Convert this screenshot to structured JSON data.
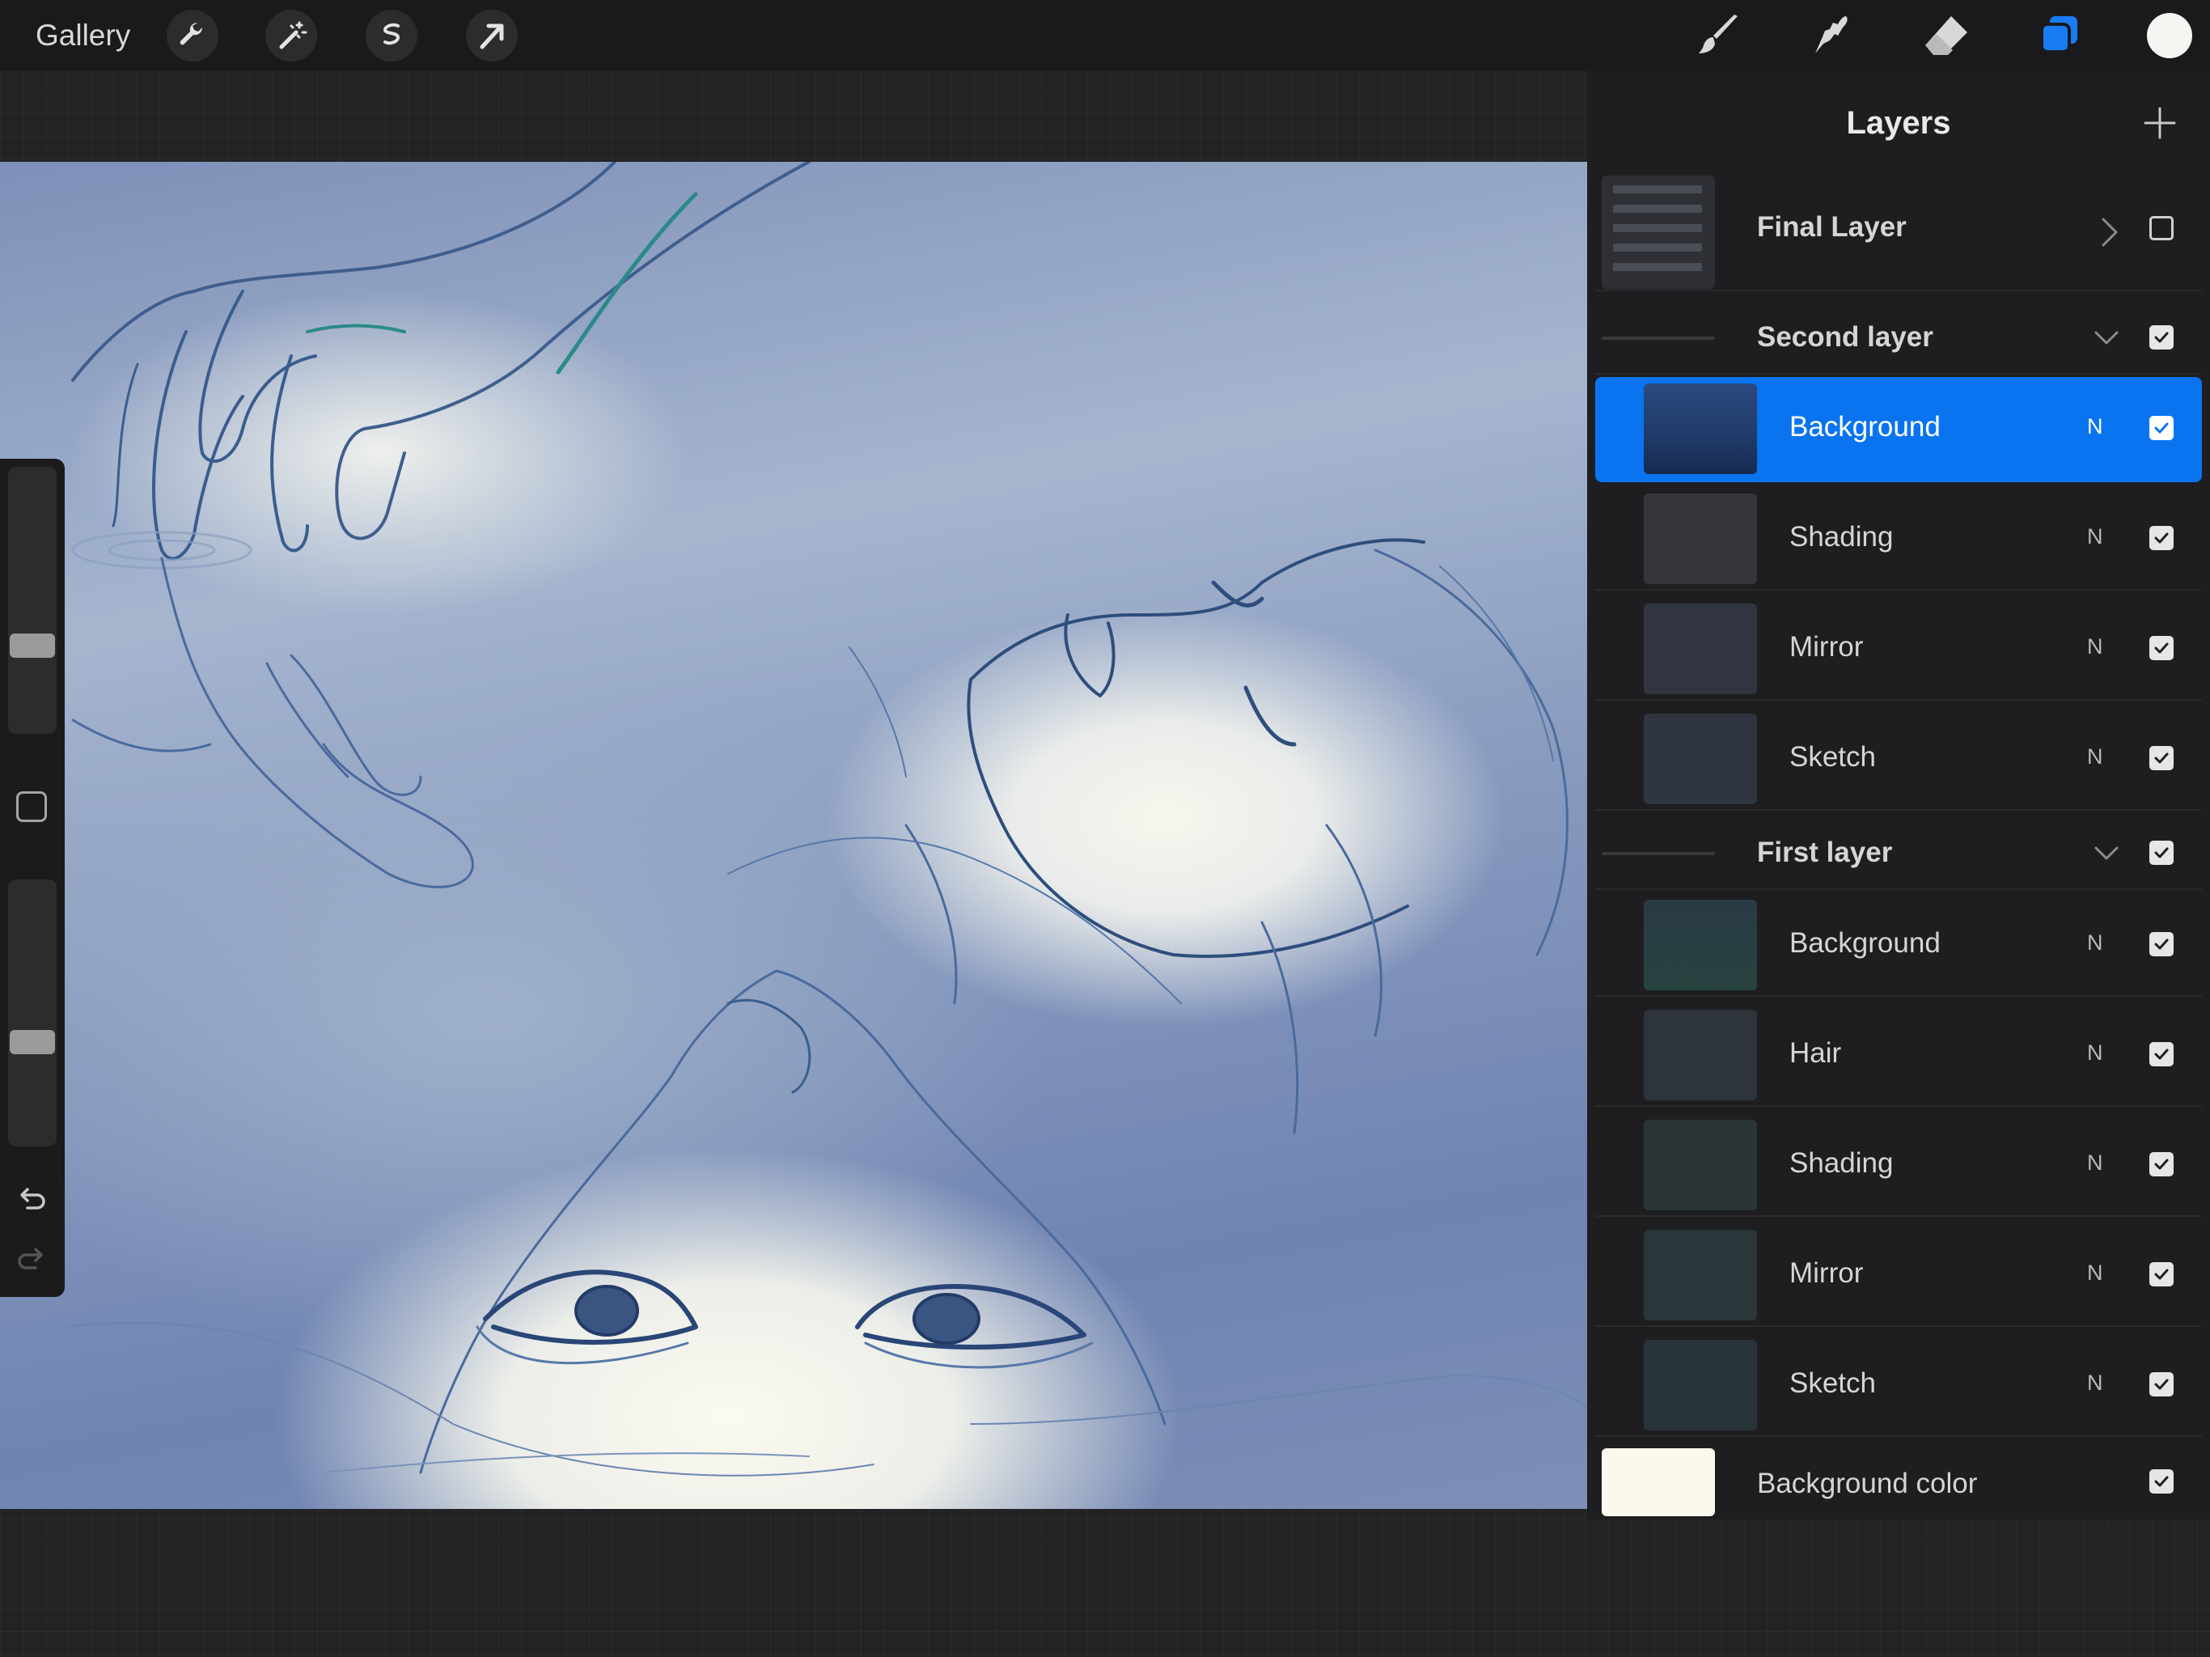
{
  "topbar": {
    "gallery_label": "Gallery",
    "left_tools": [
      "wrench-icon",
      "magic-wand-icon",
      "selection-icon",
      "transform-arrow-icon"
    ],
    "right_tools": [
      "brush-icon",
      "smudge-icon",
      "eraser-icon",
      "layers-icon"
    ],
    "active_color": "#f5f5f2",
    "accent": "#1a7cf5"
  },
  "layers": {
    "title": "Layers",
    "final_layer": {
      "name": "Final Layer",
      "visible": false
    },
    "groups": [
      {
        "name": "Second layer",
        "expanded": true,
        "visible": true,
        "layers": [
          {
            "name": "Background",
            "blend": "N",
            "visible": true,
            "selected": true
          },
          {
            "name": "Shading",
            "blend": "N",
            "visible": true
          },
          {
            "name": "Mirror",
            "blend": "N",
            "visible": true
          },
          {
            "name": "Sketch",
            "blend": "N",
            "visible": true
          }
        ]
      },
      {
        "name": "First layer",
        "expanded": true,
        "visible": true,
        "layers": [
          {
            "name": "Background",
            "blend": "N",
            "visible": true
          },
          {
            "name": "Hair",
            "blend": "N",
            "visible": true
          },
          {
            "name": "Shading",
            "blend": "N",
            "visible": true
          },
          {
            "name": "Mirror",
            "blend": "N",
            "visible": true
          },
          {
            "name": "Sketch",
            "blend": "N",
            "visible": true
          }
        ]
      }
    ],
    "background_color": {
      "name": "Background color",
      "swatch": "#fbf9ec",
      "visible": true
    }
  },
  "sidebar": {
    "brush_size_level": 0.65,
    "opacity_level": 0.6
  }
}
